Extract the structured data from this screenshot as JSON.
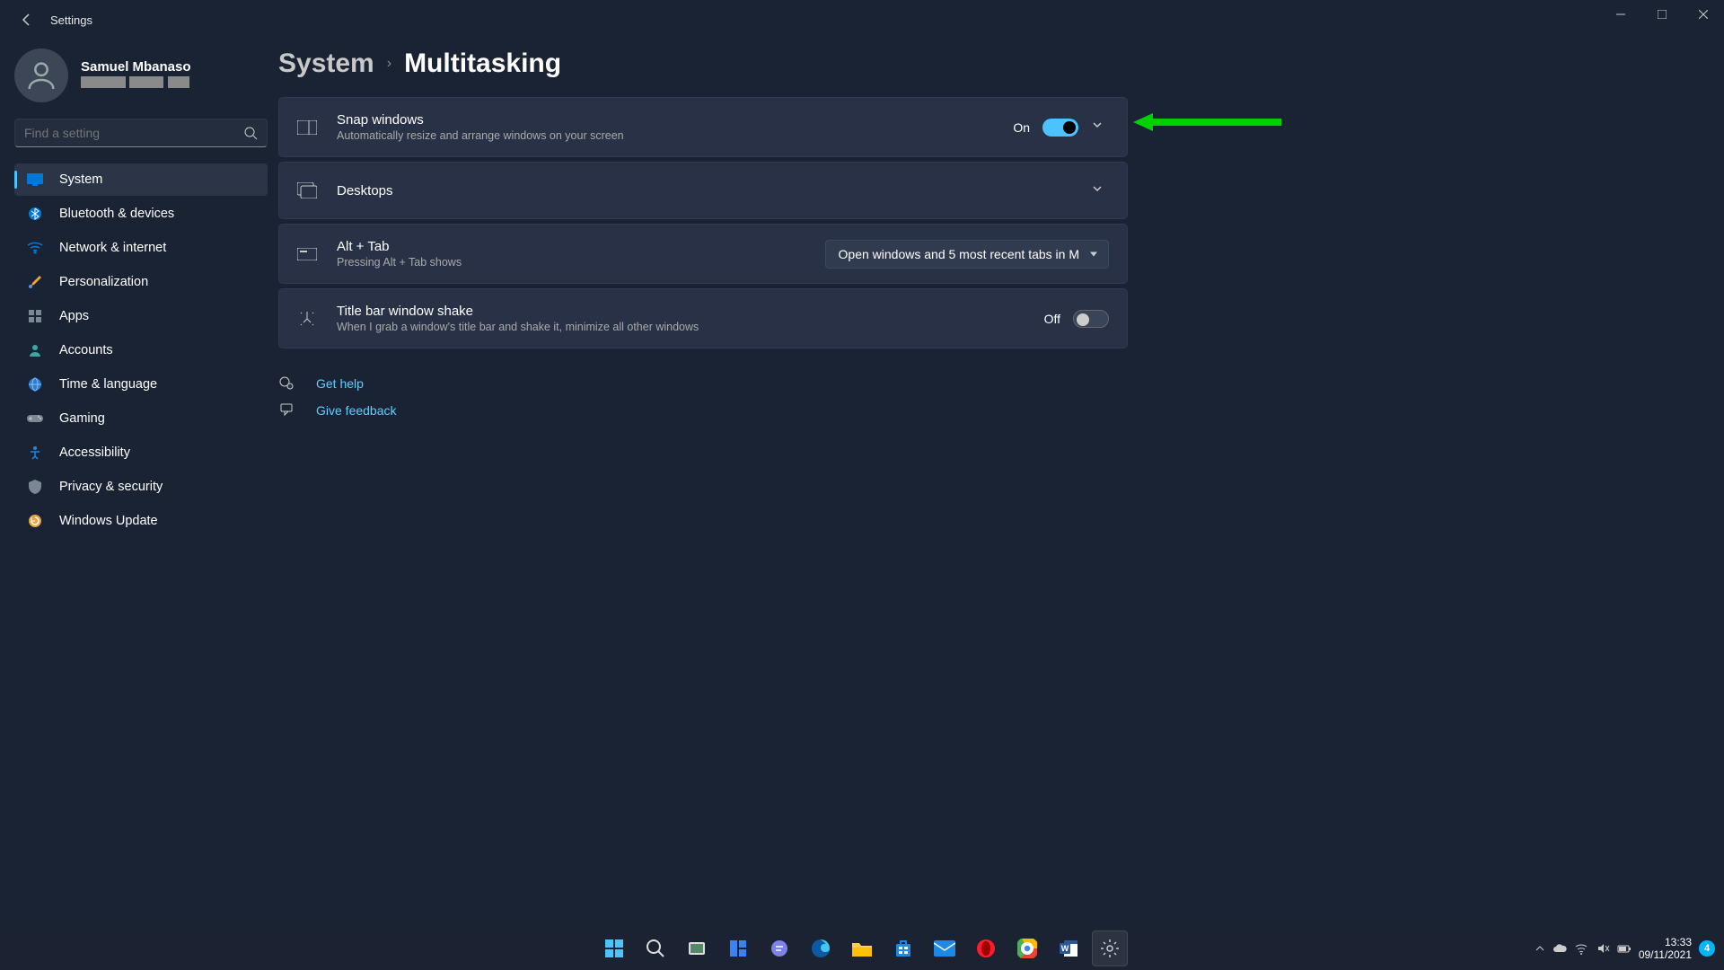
{
  "window": {
    "title": "Settings"
  },
  "profile": {
    "name": "Samuel Mbanaso"
  },
  "search": {
    "placeholder": "Find a setting"
  },
  "nav": [
    {
      "label": "System",
      "icon": "display",
      "active": true
    },
    {
      "label": "Bluetooth & devices",
      "icon": "bluetooth"
    },
    {
      "label": "Network & internet",
      "icon": "wifi"
    },
    {
      "label": "Personalization",
      "icon": "brush"
    },
    {
      "label": "Apps",
      "icon": "apps"
    },
    {
      "label": "Accounts",
      "icon": "person"
    },
    {
      "label": "Time & language",
      "icon": "globe"
    },
    {
      "label": "Gaming",
      "icon": "gamepad"
    },
    {
      "label": "Accessibility",
      "icon": "access"
    },
    {
      "label": "Privacy & security",
      "icon": "shield"
    },
    {
      "label": "Windows Update",
      "icon": "update"
    }
  ],
  "breadcrumb": {
    "parent": "System",
    "current": "Multitasking"
  },
  "settings": {
    "snap": {
      "title": "Snap windows",
      "desc": "Automatically resize and arrange windows on your screen",
      "state": "On"
    },
    "desktops": {
      "title": "Desktops"
    },
    "alttab": {
      "title": "Alt + Tab",
      "desc": "Pressing Alt + Tab shows",
      "value": "Open windows and 5 most recent tabs in M"
    },
    "shake": {
      "title": "Title bar window shake",
      "desc": "When I grab a window's title bar and shake it, minimize all other windows",
      "state": "Off"
    }
  },
  "help": {
    "get": "Get help",
    "feedback": "Give feedback"
  },
  "tray": {
    "time": "13:33",
    "date": "09/11/2021",
    "badge": "4"
  }
}
